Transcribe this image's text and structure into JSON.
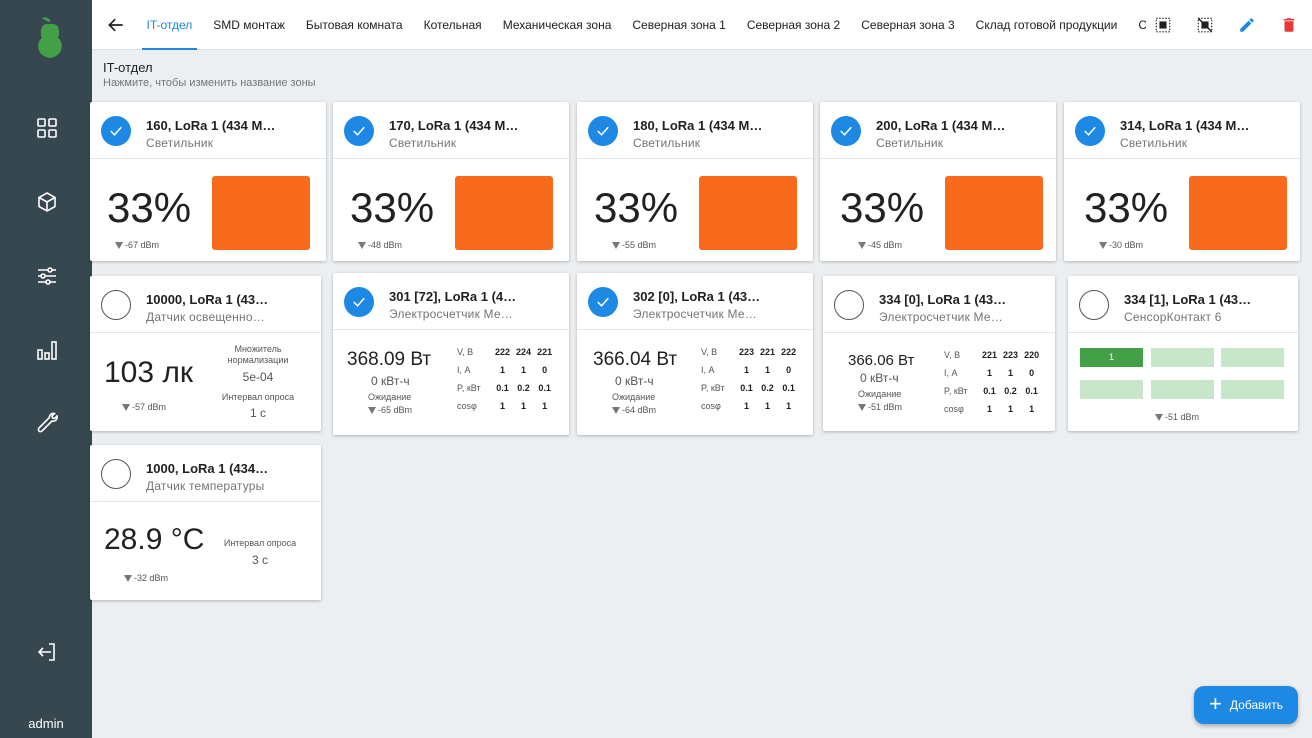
{
  "sidebar": {
    "items": [
      {
        "name": "dashboard-icon"
      },
      {
        "name": "cube-icon"
      },
      {
        "name": "sliders-icon"
      },
      {
        "name": "bar-chart-icon"
      },
      {
        "name": "wrench-icon"
      },
      {
        "name": "logout-icon"
      }
    ],
    "user": "admin"
  },
  "topbar": {
    "tabs": [
      {
        "label": "IT-отдел",
        "active": true
      },
      {
        "label": "SMD монтаж"
      },
      {
        "label": "Бытовая комната"
      },
      {
        "label": "Котельная"
      },
      {
        "label": "Механическая зона"
      },
      {
        "label": "Северная зона 1"
      },
      {
        "label": "Северная зона 2"
      },
      {
        "label": "Северная зона 3"
      },
      {
        "label": "Склад готовой продукции"
      },
      {
        "label": "Скл"
      }
    ],
    "tools": [
      "select-all-icon",
      "deselect-icon",
      "edit-icon",
      "delete-icon"
    ]
  },
  "zone": {
    "title": "IT-отдел",
    "hint": "Нажмите, чтобы изменить название зоны"
  },
  "colors": {
    "accent": "#1e88e5",
    "sidebar": "#37474f",
    "lamp": "#fa6a1c",
    "contact_on": "#43a047",
    "contact_off": "#c8e6c9",
    "delete": "#e53935"
  },
  "cards": {
    "lamp1": {
      "title": "160, LoRa 1 (434 M…",
      "subtitle": "Светильник",
      "value": "33%",
      "signal": "-67 dBm",
      "checked": true
    },
    "lamp2": {
      "title": "170, LoRa 1 (434 M…",
      "subtitle": "Светильник",
      "value": "33%",
      "signal": "-48 dBm",
      "checked": true
    },
    "lamp3": {
      "title": "180, LoRa 1 (434 M…",
      "subtitle": "Светильник",
      "value": "33%",
      "signal": "-55 dBm",
      "checked": true
    },
    "lamp4": {
      "title": "200, LoRa 1 (434 M…",
      "subtitle": "Светильник",
      "value": "33%",
      "signal": "-45 dBm",
      "checked": true
    },
    "lamp5": {
      "title": "314, LoRa 1 (434 M…",
      "subtitle": "Светильник",
      "value": "33%",
      "signal": "-30 dBm",
      "checked": true
    },
    "light": {
      "title": "10000, LoRa 1 (43…",
      "subtitle": "Датчик освещенно…",
      "value": "103 лк",
      "signal": "-57 dBm",
      "mult_label": "Множитель нормализации",
      "mult_value": "5e-04",
      "interval_label": "Интервал опроса",
      "interval_value": "1 с"
    },
    "meter1": {
      "title": "301 [72], LoRa 1 (4…",
      "subtitle": "Электросчетчик Ме…",
      "power": "368.09 Вт",
      "energy": "0 кВт-ч",
      "state": "Ожидание",
      "signal": "-65 dBm",
      "rows": [
        {
          "h": "V, В",
          "v": [
            "222",
            "224",
            "221"
          ]
        },
        {
          "h": "I, А",
          "v": [
            "1",
            "1",
            "0"
          ]
        },
        {
          "h": "P, кВт",
          "v": [
            "0.1",
            "0.2",
            "0.1"
          ]
        },
        {
          "h": "cosφ",
          "v": [
            "1",
            "1",
            "1"
          ]
        }
      ]
    },
    "meter2": {
      "title": "302 [0], LoRa 1 (43…",
      "subtitle": "Электросчетчик Ме…",
      "power": "366.04 Вт",
      "energy": "0 кВт-ч",
      "state": "Ожидание",
      "signal": "-64 dBm",
      "rows": [
        {
          "h": "V, В",
          "v": [
            "223",
            "221",
            "222"
          ]
        },
        {
          "h": "I, А",
          "v": [
            "1",
            "1",
            "0"
          ]
        },
        {
          "h": "P, кВт",
          "v": [
            "0.1",
            "0.2",
            "0.1"
          ]
        },
        {
          "h": "cosφ",
          "v": [
            "1",
            "1",
            "1"
          ]
        }
      ]
    },
    "meter3": {
      "title": "334 [0], LoRa 1 (43…",
      "subtitle": "Электросчетчик Ме…",
      "power": "366.06 Вт",
      "energy": "0 кВт-ч",
      "state": "Ожидание",
      "signal": "-51 dBm",
      "rows": [
        {
          "h": "V, В",
          "v": [
            "221",
            "223",
            "220"
          ]
        },
        {
          "h": "I, А",
          "v": [
            "1",
            "1",
            "0"
          ]
        },
        {
          "h": "P, кВт",
          "v": [
            "0.1",
            "0.2",
            "0.1"
          ]
        },
        {
          "h": "cosφ",
          "v": [
            "1",
            "1",
            "1"
          ]
        }
      ]
    },
    "contact": {
      "title": "334 [1], LoRa 1 (43…",
      "subtitle": "СенсорКонтакт 6",
      "first_label": "1",
      "signal": "-51 dBm"
    },
    "temp": {
      "title": "1000, LoRa 1 (434…",
      "subtitle": "Датчик температуры",
      "value": "28.9 °C",
      "signal": "-32 dBm",
      "interval_label": "Интервал опроса",
      "interval_value": "3 с"
    }
  },
  "add_button": "Добавить"
}
